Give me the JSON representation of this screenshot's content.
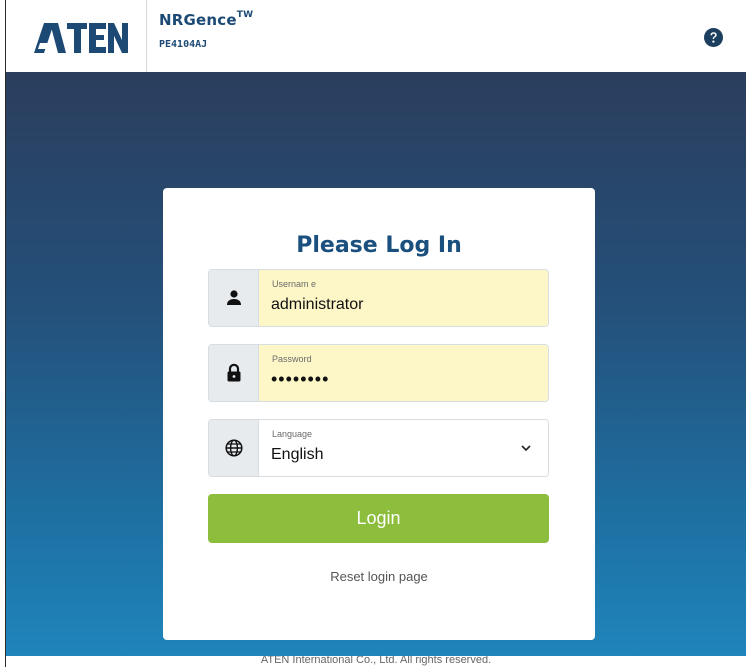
{
  "header": {
    "logo_text": "ATEN",
    "product_name": "NRGence",
    "product_name_mark": "TW",
    "model": "PE4104AJ",
    "help_icon": "question-circle-icon"
  },
  "login": {
    "title": "Please Log In",
    "username": {
      "label": "Usernam e",
      "value": "administrator",
      "icon": "user-icon"
    },
    "password": {
      "label": "Password",
      "value": "••••••••",
      "icon": "lock-icon"
    },
    "language": {
      "label": "Language",
      "value": "English",
      "icon": "globe-icon"
    },
    "login_button": "Login",
    "reset_link": "Reset login page"
  },
  "footer": {
    "copyright": "ATEN International Co., Ltd. All rights reserved."
  },
  "colors": {
    "brand_blue": "#1a4f7e",
    "login_green": "#8cbd3c",
    "autofill_yellow": "#fdf7c8",
    "bg_top": "#2b3e5d",
    "bg_bottom": "#1f85bb"
  }
}
